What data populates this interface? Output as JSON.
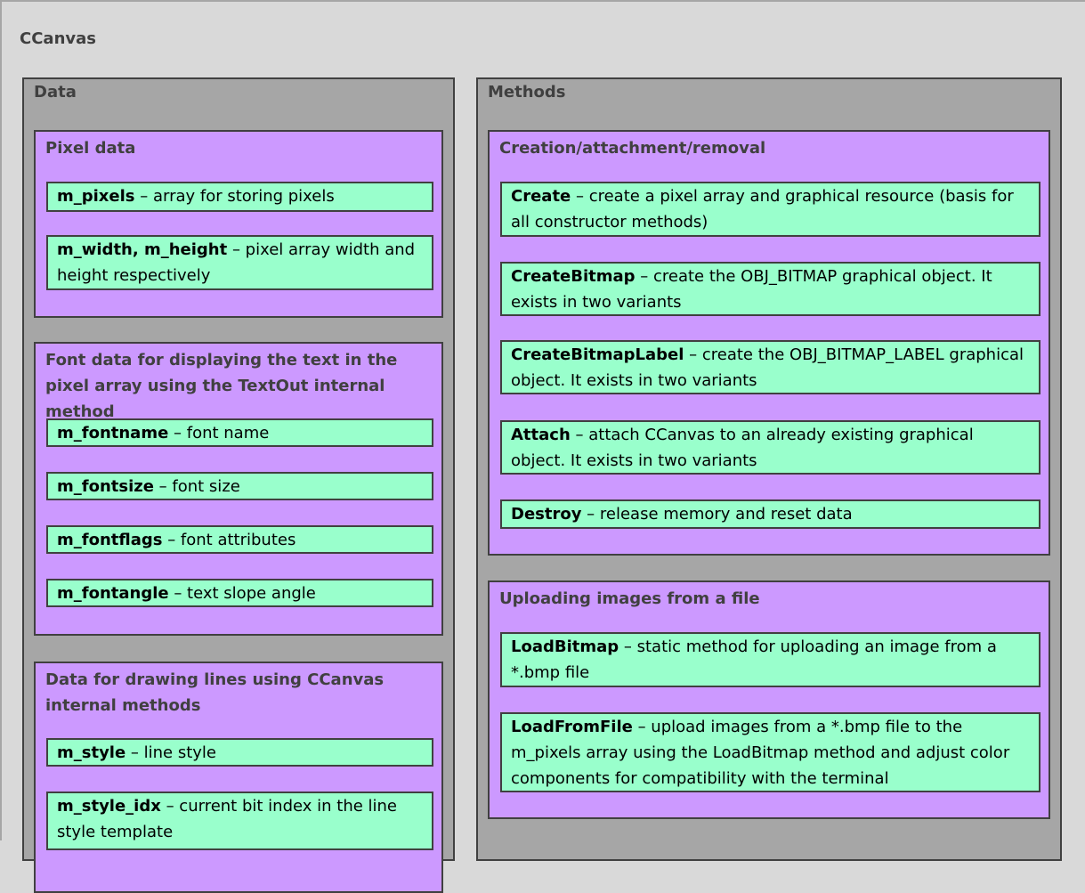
{
  "title": "CCanvas",
  "data": {
    "heading": "Data",
    "groups": [
      {
        "heading": "Pixel data",
        "items": [
          {
            "name": "m_pixels",
            "desc": " – array for storing pixels"
          },
          {
            "name": "m_width, m_height",
            "desc": " – pixel array width and height respectively"
          }
        ]
      },
      {
        "heading": "Font data for displaying the text in the pixel array using the TextOut internal method",
        "items": [
          {
            "name": "m_fontname",
            "desc": " – font name"
          },
          {
            "name": "m_fontsize",
            "desc": " – font size"
          },
          {
            "name": "m_fontflags",
            "desc": " – font attributes"
          },
          {
            "name": "m_fontangle",
            "desc": " – text slope angle"
          }
        ]
      },
      {
        "heading": "Data for drawing lines using CCanvas internal methods",
        "items": [
          {
            "name": "m_style",
            "desc": " – line style"
          },
          {
            "name": "m_style_idx",
            "desc": " – current bit index in the line style template"
          }
        ]
      }
    ]
  },
  "methods": {
    "heading": "Methods",
    "groups": [
      {
        "heading": "Creation/attachment/removal",
        "items": [
          {
            "name": "Create",
            "desc": " – create a pixel array and graphical resource (basis for all constructor methods)"
          },
          {
            "name": "CreateBitmap",
            "desc": " – create the OBJ_BITMAP graphical object. It exists in two variants"
          },
          {
            "name": "CreateBitmapLabel",
            "desc": " – create the OBJ_BITMAP_LABEL graphical object. It exists in two variants"
          },
          {
            "name": "Attach",
            "desc": " – attach CCanvas to an already existing graphical object. It exists in two variants"
          },
          {
            "name": "Destroy",
            "desc": " – release memory and reset data"
          }
        ]
      },
      {
        "heading": "Uploading images from a file",
        "items": [
          {
            "name": "LoadBitmap",
            "desc": " – static method for uploading an image from a *.bmp file"
          },
          {
            "name": "LoadFromFile",
            "desc": " – upload images from a *.bmp file to the m_pixels array using the LoadBitmap method and adjust color components for compatibility with the terminal"
          }
        ]
      }
    ]
  }
}
